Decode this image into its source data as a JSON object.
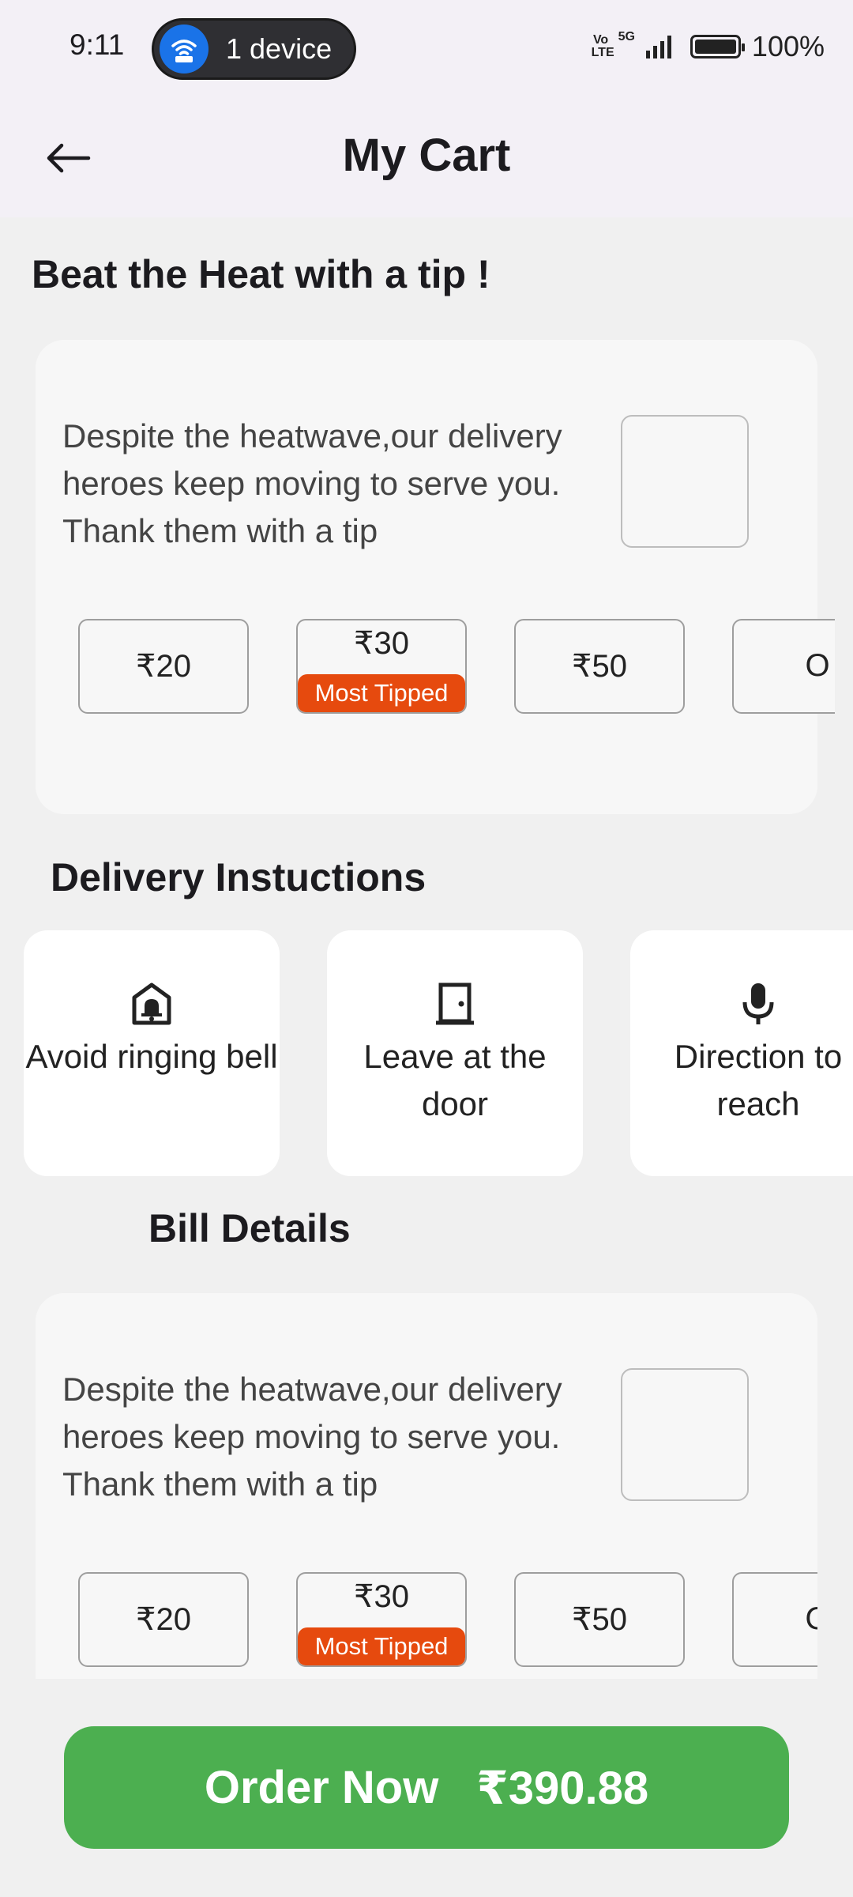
{
  "status_bar": {
    "time": "9:11",
    "hotspot_label": "1 device",
    "network": "5G",
    "volte": "Vo LTE",
    "battery": "100%"
  },
  "app_bar": {
    "title": "My Cart"
  },
  "tip_section": {
    "title": "Beat the Heat with a tip !",
    "description": "Despite the heatwave,our delivery heroes keep moving to serve you. Thank them with a tip",
    "options": [
      {
        "label": "₹20"
      },
      {
        "label": "₹30",
        "badge": "Most Tipped"
      },
      {
        "label": "₹50"
      },
      {
        "label": "O"
      }
    ]
  },
  "delivery_instructions": {
    "title": "Delivery Instuctions",
    "items": [
      {
        "label": "Avoid ringing bell",
        "icon": "bell-off-icon"
      },
      {
        "label": "Leave at the door",
        "icon": "door-icon"
      },
      {
        "label": "Direction to reach",
        "icon": "mic-icon"
      }
    ]
  },
  "bill_details": {
    "title": "Bill Details",
    "description": "Despite the heatwave,our delivery heroes keep moving to serve you. Thank them with a tip",
    "options": [
      {
        "label": "₹20"
      },
      {
        "label": "₹30",
        "badge": "Most Tipped"
      },
      {
        "label": "₹50"
      },
      {
        "label": "O"
      }
    ]
  },
  "order_button": {
    "label": "Order Now",
    "amount": "₹390.88"
  },
  "colors": {
    "accent_green": "#4caf50",
    "badge_orange": "#e64a0e",
    "hotspot_blue": "#1a73e8"
  }
}
